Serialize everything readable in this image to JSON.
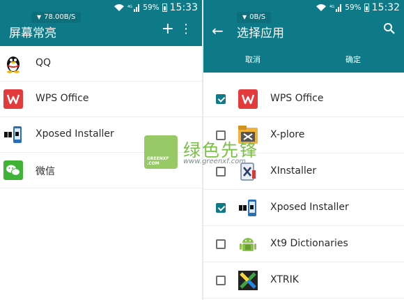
{
  "left": {
    "status": {
      "net_speed": "78.00B/S",
      "battery": "59%",
      "time": "15:33"
    },
    "appbar": {
      "title": "屏幕常亮",
      "add_icon": "plus-icon",
      "more_icon": "more-vert-icon"
    },
    "apps": [
      {
        "name": "QQ",
        "icon": "qq-penguin-icon"
      },
      {
        "name": "WPS Office",
        "icon": "wps-office-icon"
      },
      {
        "name": "Xposed Installer",
        "icon": "xposed-icon"
      },
      {
        "name": "微信",
        "icon": "wechat-icon"
      }
    ]
  },
  "right": {
    "status": {
      "net_speed": "0B/S",
      "battery": "59%",
      "time": "15:32"
    },
    "appbar": {
      "title": "选择应用",
      "back_icon": "arrow-back-icon",
      "search_icon": "search-icon"
    },
    "actions": {
      "cancel": "取消",
      "confirm": "确定"
    },
    "apps": [
      {
        "name": "WPS Office",
        "checked": true,
        "icon": "wps-office-icon"
      },
      {
        "name": "X-plore",
        "checked": false,
        "icon": "x-plore-icon"
      },
      {
        "name": "XInstaller",
        "checked": false,
        "icon": "xinstaller-icon"
      },
      {
        "name": "Xposed Installer",
        "checked": true,
        "icon": "xposed-icon"
      },
      {
        "name": "Xt9 Dictionaries",
        "checked": false,
        "icon": "android-icon"
      },
      {
        "name": "XTRIK",
        "checked": false,
        "icon": "xtrik-icon"
      }
    ]
  },
  "watermark": {
    "name": "绿色先锋",
    "url": "www.greenxf.com",
    "logo_text": "GREENXF .COM"
  },
  "colors": {
    "primary": "#0f7a87",
    "checkbox": "#0f7a87",
    "wps": "#e33b3b",
    "wechat": "#3fb336"
  }
}
